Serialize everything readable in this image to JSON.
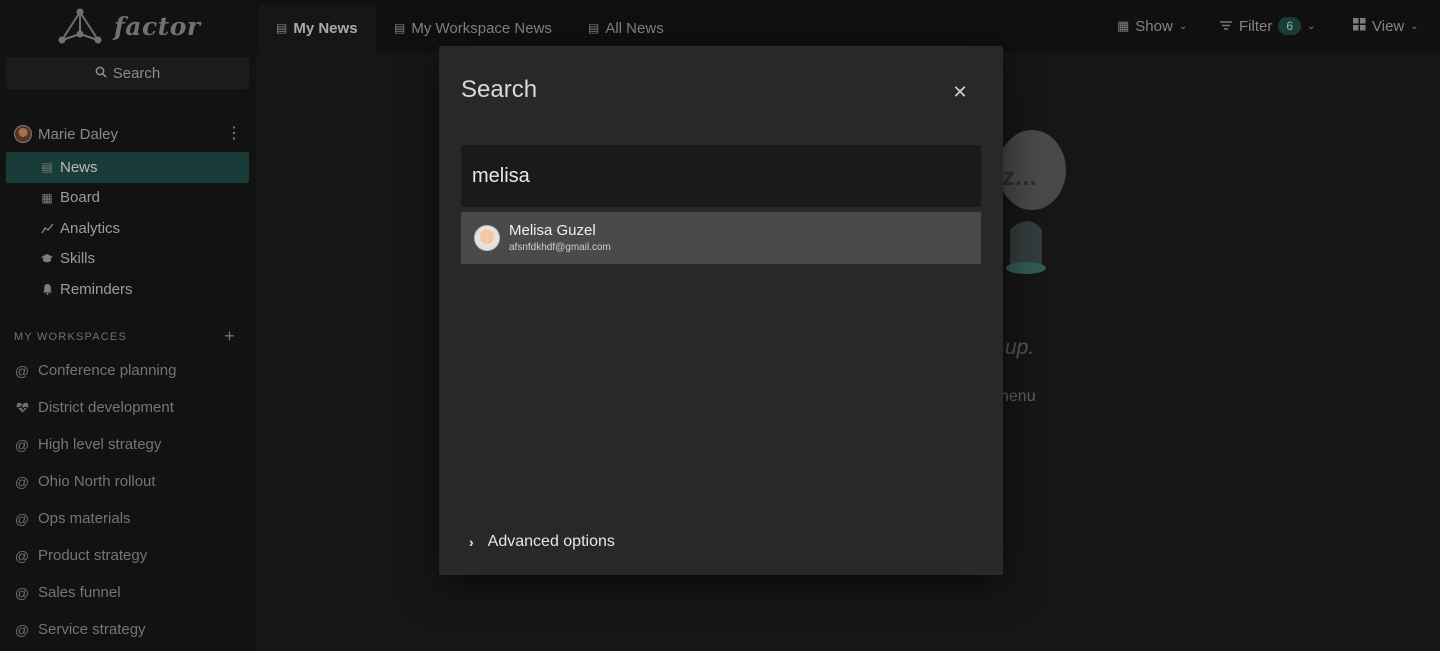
{
  "app": {
    "name": "factor"
  },
  "sidebar": {
    "search_label": "Search",
    "user": {
      "name": "Marie Daley"
    },
    "nav": [
      {
        "label": "News",
        "icon": "news-icon",
        "active": true
      },
      {
        "label": "Board",
        "icon": "board-icon",
        "active": false
      },
      {
        "label": "Analytics",
        "icon": "analytics-icon",
        "active": false
      },
      {
        "label": "Skills",
        "icon": "skills-icon",
        "active": false
      },
      {
        "label": "Reminders",
        "icon": "bell-icon",
        "active": false
      }
    ],
    "workspaces_heading": "MY WORKSPACES",
    "workspaces": [
      {
        "label": "Conference planning",
        "icon": "at-icon"
      },
      {
        "label": "District development",
        "icon": "heart-icon"
      },
      {
        "label": "High level strategy",
        "icon": "at-icon"
      },
      {
        "label": "Ohio North rollout",
        "icon": "at-icon"
      },
      {
        "label": "Ops materials",
        "icon": "at-icon"
      },
      {
        "label": "Product strategy",
        "icon": "at-icon"
      },
      {
        "label": "Sales funnel",
        "icon": "at-icon"
      },
      {
        "label": "Service strategy",
        "icon": "at-icon"
      }
    ]
  },
  "topbar": {
    "tabs": [
      {
        "label": "My News",
        "active": true
      },
      {
        "label": "My Workspace News",
        "active": false
      },
      {
        "label": "All News",
        "active": false
      }
    ],
    "show_label": "Show",
    "filter_label": "Filter",
    "filter_count": "6",
    "view_label": "View"
  },
  "background": {
    "empty_text_partial": "up.",
    "menu_text_partial": "nenu",
    "bubble_text": "z..."
  },
  "modal": {
    "title": "Search",
    "query": "melisa",
    "results": [
      {
        "name": "Melisa Guzel",
        "email": "afsnfdkhdf@gmail.com"
      }
    ],
    "advanced_label": "Advanced options"
  },
  "colors": {
    "accent": "#1f4a46",
    "background": "#1c1c1c",
    "modal": "#282828",
    "result_highlight": "#4a4a4a"
  }
}
